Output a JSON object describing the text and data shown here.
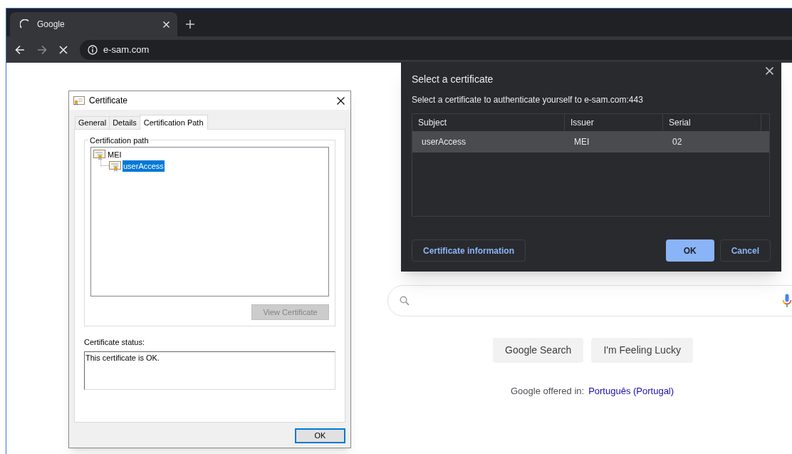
{
  "browser": {
    "tabs": [
      {
        "title": "Google",
        "loading": true,
        "selected": true
      }
    ],
    "address": "e-sam.com"
  },
  "page": {
    "search_buttons": [
      "Google Search",
      "I'm Feeling Lucky"
    ],
    "offered_label": "Google offered in:",
    "language_link": "Português (Portugal)"
  },
  "certificate_dialog": {
    "title": "Certificate",
    "tabs": [
      {
        "label": "General",
        "selected": false
      },
      {
        "label": "Details",
        "selected": false
      },
      {
        "label": "Certification Path",
        "selected": true
      }
    ],
    "group_label": "Certification path",
    "tree": [
      {
        "label": "MEI",
        "selected": false,
        "children": [
          {
            "label": "userAccess",
            "selected": true
          }
        ]
      }
    ],
    "view_button": {
      "label": "View Certificate",
      "disabled": true
    },
    "status_label": "Certificate status:",
    "status_text": "This certificate is OK.",
    "ok_button": "OK"
  },
  "select_dialog": {
    "title": "Select a certificate",
    "message": "Select a certificate to authenticate yourself to e-sam.com:443",
    "columns": [
      "Subject",
      "Issuer",
      "Serial"
    ],
    "rows": [
      {
        "cells": [
          "userAccess",
          "MEI",
          "02"
        ],
        "selected": true
      }
    ],
    "buttons": [
      {
        "label": "Certificate information",
        "kind": "secondary"
      },
      {
        "label": "OK",
        "kind": "primary"
      },
      {
        "label": "Cancel",
        "kind": "secondary"
      }
    ]
  }
}
